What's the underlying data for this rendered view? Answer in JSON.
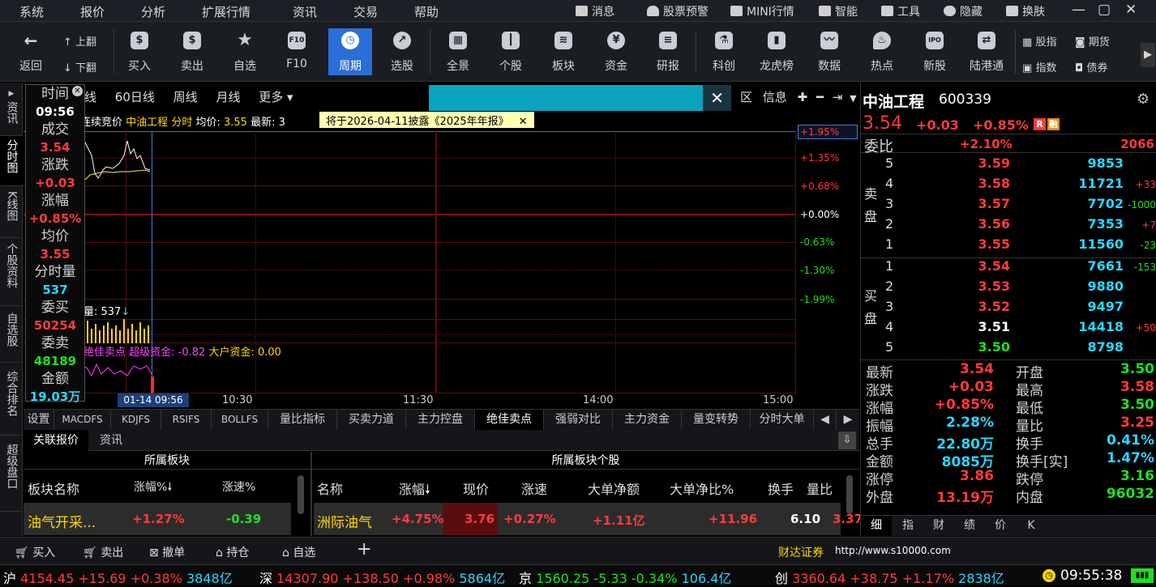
{
  "menu": {
    "items": [
      "系统",
      "报价",
      "分析",
      "扩展行情",
      "资讯",
      "交易",
      "帮助"
    ],
    "right": [
      "消息",
      "股票预警",
      "MINI行情",
      "智能",
      "工具",
      "隐藏",
      "换肤"
    ]
  },
  "toolbar": {
    "back": "返回",
    "up": "上翻",
    "down": "下翻",
    "buttons": [
      "买入",
      "卖出",
      "自选",
      "F10",
      "周期",
      "选股",
      "全景",
      "个股",
      "板块",
      "资金",
      "研报",
      "科创",
      "龙虎榜",
      "数据",
      "热点",
      "新股",
      "陆港通"
    ],
    "right": [
      "股指",
      "期货",
      "指数",
      "债券"
    ]
  },
  "left_tabs": [
    "资讯",
    "分时图",
    "K线图",
    "个股资料",
    "自选股",
    "综合排名",
    "超级盘口"
  ],
  "chart": {
    "periods": [
      "日线",
      "60日线",
      "周线",
      "月线",
      "更多"
    ],
    "notice": "将于2026-04-11披露《2025年年报》",
    "header": {
      "mode": "连续竞价",
      "name": "中油工程",
      "type": "分时",
      "avg_label": "均价:",
      "avg": "3.55",
      "last_label": "最新:",
      "last": "3"
    },
    "right_tools": [
      "区",
      "信息"
    ],
    "pct_labels": [
      {
        "t": "+1.95%",
        "c": "red"
      },
      {
        "t": "+1.35%",
        "c": "red"
      },
      {
        "t": "+0.68%",
        "c": "red"
      },
      {
        "t": "+0.00%",
        "c": "white"
      },
      {
        "t": "-0.63%",
        "c": "green"
      },
      {
        "t": "-1.30%",
        "c": "green"
      },
      {
        "t": "-1.99%",
        "c": "green"
      }
    ],
    "vol_label": "量: 537",
    "indicator": {
      "a": "绝佳卖点",
      "b": "超级资金: -0.82",
      "c": "大户资金: 0.00"
    },
    "time_labels": [
      "01-14 09:56",
      "10:30",
      "11:30",
      "14:00",
      "15:00"
    ]
  },
  "infobox": [
    {
      "l": "时间",
      "v": "09:56",
      "c": "white"
    },
    {
      "l": "成交",
      "v": "3.54",
      "c": "red"
    },
    {
      "l": "涨跌",
      "v": "+0.03",
      "c": "red"
    },
    {
      "l": "涨幅",
      "v": "+0.85%",
      "c": "red"
    },
    {
      "l": "均价",
      "v": "3.55",
      "c": "red"
    },
    {
      "l": "分时量",
      "v": "537",
      "c": "cyan"
    },
    {
      "l": "委买",
      "v": "50254",
      "c": "red"
    },
    {
      "l": "委卖",
      "v": "48189",
      "c": "green"
    },
    {
      "l": "金额",
      "v": "19.03万",
      "c": "cyan"
    }
  ],
  "bottom_tabs": [
    "设置",
    "MACDFS",
    "KDJFS",
    "RSIFS",
    "BOLLFS",
    "量比指标",
    "买卖力道",
    "主力控盘",
    "绝佳卖点",
    "强弱对比",
    "主力资金",
    "量变转势",
    "分时大单"
  ],
  "rel": {
    "tabs": [
      "关联报价",
      "资讯"
    ],
    "sector_title": "所属板块",
    "stocks_title": "所属板块个股",
    "sector_cols": [
      "板块名称",
      "涨幅%",
      "涨速%"
    ],
    "sector_rows": [
      {
        "name": "油气开采...",
        "chg": "+1.27%",
        "spd": "-0.39"
      }
    ],
    "stock_cols": [
      "名称",
      "涨幅",
      "现价",
      "涨速",
      "大单净额",
      "大单净比%",
      "换手",
      "量比"
    ],
    "stock_rows": [
      {
        "name": "洲际油气",
        "chg": "+4.75%",
        "price": "3.76",
        "spd": "+0.27%",
        "net": "+1.11亿",
        "ratio": "+11.96",
        "turn": "6.10",
        "vr": "3.37"
      }
    ]
  },
  "quote": {
    "name": "中油工程",
    "code": "600339",
    "price": "3.54",
    "chg": "+0.03",
    "pct": "+0.85%",
    "badges": [
      "R",
      "融"
    ],
    "webi_label": "委比",
    "webi": "+2.10%",
    "webi_diff": "2066",
    "sell_label": [
      "卖",
      "盘"
    ],
    "buy_label": [
      "买",
      "盘"
    ],
    "asks": [
      {
        "lv": "5",
        "p": "3.59",
        "v": "9853",
        "d": "",
        "pc": "red"
      },
      {
        "lv": "4",
        "p": "3.58",
        "v": "11721",
        "d": "+33",
        "dc": "red",
        "pc": "red"
      },
      {
        "lv": "3",
        "p": "3.57",
        "v": "7702",
        "d": "-1000",
        "dc": "green",
        "pc": "red"
      },
      {
        "lv": "2",
        "p": "3.56",
        "v": "7353",
        "d": "+7",
        "dc": "red",
        "pc": "red"
      },
      {
        "lv": "1",
        "p": "3.55",
        "v": "11560",
        "d": "-23",
        "dc": "green",
        "pc": "red"
      }
    ],
    "bids": [
      {
        "lv": "1",
        "p": "3.54",
        "v": "7661",
        "d": "-153",
        "dc": "green",
        "pc": "red"
      },
      {
        "lv": "2",
        "p": "3.53",
        "v": "9880",
        "d": "",
        "pc": "red"
      },
      {
        "lv": "3",
        "p": "3.52",
        "v": "9497",
        "d": "",
        "pc": "red"
      },
      {
        "lv": "4",
        "p": "3.51",
        "v": "14418",
        "d": "+50",
        "dc": "red",
        "pc": "white"
      },
      {
        "lv": "5",
        "p": "3.50",
        "v": "8798",
        "d": "",
        "pc": "green"
      }
    ],
    "stats": [
      {
        "l1": "最新",
        "v1": "3.54",
        "c1": "red",
        "l2": "开盘",
        "v2": "3.50",
        "c2": "green"
      },
      {
        "l1": "涨跌",
        "v1": "+0.03",
        "c1": "red",
        "l2": "最高",
        "v2": "3.58",
        "c2": "red"
      },
      {
        "l1": "涨幅",
        "v1": "+0.85%",
        "c1": "red",
        "l2": "最低",
        "v2": "3.50",
        "c2": "green"
      },
      {
        "l1": "振幅",
        "v1": "2.28%",
        "c1": "cyan",
        "l2": "量比",
        "v2": "3.25",
        "c2": "red"
      },
      {
        "l1": "总手",
        "v1": "22.80万",
        "c1": "cyan",
        "l2": "换手",
        "v2": "0.41%",
        "c2": "cyan"
      },
      {
        "l1": "金额",
        "v1": "8085万",
        "c1": "cyan",
        "l2": "换手[实]",
        "v2": "1.47%",
        "c2": "cyan"
      },
      {
        "l1": "涨停",
        "v1": "3.86",
        "c1": "red",
        "l2": "跌停",
        "v2": "3.16",
        "c2": "green"
      },
      {
        "l1": "外盘",
        "v1": "13.19万",
        "c1": "red",
        "l2": "内盘",
        "v2": "96032",
        "c2": "green"
      }
    ],
    "bottom_tabs": [
      "细",
      "指",
      "财",
      "绩",
      "价",
      "K"
    ]
  },
  "tradebar": {
    "items": [
      "买入",
      "卖出",
      "撤单",
      "持仓",
      "自选"
    ],
    "plus": "+",
    "broker": "财达证券",
    "url": "http://www.s10000.com"
  },
  "indexbar": [
    {
      "n": "沪",
      "v": "4154.45",
      "c": "+15.69",
      "p": "+0.38%",
      "a": "3848亿",
      "col": "red"
    },
    {
      "n": "深",
      "v": "14307.90",
      "c": "+138.50",
      "p": "+0.98%",
      "a": "5864亿",
      "col": "red"
    },
    {
      "n": "京",
      "v": "1560.25",
      "c": "-5.33",
      "p": "-0.34%",
      "a": "106.4亿",
      "col": "green"
    },
    {
      "n": "创",
      "v": "3360.64",
      "c": "+38.75",
      "p": "+1.17%",
      "a": "2838亿",
      "col": "red"
    }
  ],
  "clock": "09:55:38"
}
